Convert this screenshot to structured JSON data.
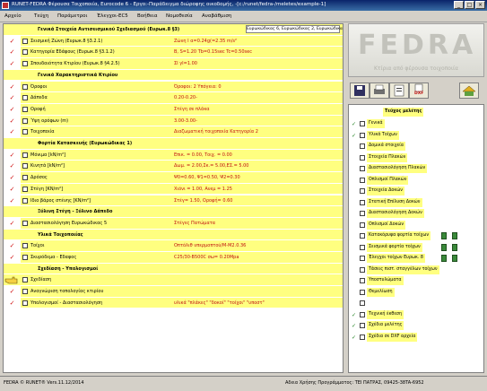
{
  "window": {
    "title": "RUNET-FEDRA Φέρουσα Τοιχοποιία, Eurocode 6 - Εργο:-Παράδειγμα διώροφης οικοδομής, -[c:/runet/fedra-/meletes/example-1]"
  },
  "menu": {
    "items": [
      "Αρχείο",
      "Τεύχη",
      "Παράμετροι",
      "Έλεγχοι-EC5",
      "Βοήθεια",
      "Νομοθεσία",
      "Αναβάθμιση"
    ]
  },
  "grid": {
    "rows": [
      {
        "label": "Γενικά Στοιχεία Αντισεισμικού Σχεδιασμού (Ευρωκ.8 §3)",
        "side": "Ευρωκώδικας 6, Ευρωκώδικας 2, Ευρωκώδικας 8"
      },
      {
        "label": "Σεισμική Ζώνη (Ευρωκ.8 §3.2.1)",
        "value": "Ζώνη   Ι  α=0.24g(=2.35 m/s²"
      },
      {
        "label": "Κατηγορία Εδάφους (Ευρωκ.8 §3.1.2)",
        "value": "B,  S=1.20  Tb=0.15sec  Tc=0.50sec"
      },
      {
        "label": "Σπουδαιότητα Κτιρίου (Ευρωκ.8 §4.2.5)",
        "value": "ΣΙ   γΙ=1.00"
      },
      {
        "label": "Γενικά Χαρακτηριστικά Κτιρίου"
      },
      {
        "label": "Όροφοι",
        "value": "Όροφοι: 2    Υπόγεια: 0"
      },
      {
        "label": "Δάπεδα",
        "value": "0.20-0.20-"
      },
      {
        "label": "Οροφή",
        "value": "Στέγη σε πλάκα"
      },
      {
        "label": "Ύψη ορόφων (m)",
        "value": "3.00-3.00-"
      },
      {
        "label": "Τοιχοποιία",
        "value": "Διαζωματική τοιχοποιία    Κατηγορία 2"
      },
      {
        "label": "Φορτία Κατασκευής (Ευρωκώδικας 1)"
      },
      {
        "label": "Μόνιμα  [kN/m²]",
        "value": "Επικ. = 0.00, Τοιχ. = 0.00"
      },
      {
        "label": "Κινητά  [kN/m²]",
        "value": "Δωμ. = 2.00,Σκ.= 5.00,ΕΣ.= 5.00"
      },
      {
        "label": "Δρόσος",
        "value": "Ψ0=0.60, Ψ1=0.50, Ψ2=0.30"
      },
      {
        "label": "Στέγη [KN/m²]",
        "value": "Χιόνι = 1.00, Ανεμ = 1.25"
      },
      {
        "label": "Ιδιο βάρος στένης [KN/m²]",
        "value": "Στέγ= 1.50, Οροφή= 0.60"
      },
      {
        "label": "Ξύλινη Στέγη - Ξύλινο Δάπεδο"
      },
      {
        "label": "Διαστασιολόγηση Ευρωκώδικας 5",
        "value": "Στέγες          Πατώματα"
      },
      {
        "label": "Υλικά Τοιχοποιίας"
      },
      {
        "label": "Τοίχοι",
        "value": "Οπτόλιθ υπερμοπτού/Μ-Μ2.0.36"
      },
      {
        "label": "Σκυρόδεμα - Εδαφος",
        "value": "C25/30-B500C σω= 0.20Mpa"
      },
      {
        "label": "Σχεδίαση - Υπολογισμοί"
      },
      {
        "label": "Σχεδίαση"
      },
      {
        "label": "Αναγνώριση τοπολογίας κτιρίου"
      },
      {
        "label": "Υπολογισμοί - Διαστασιολόγηση",
        "value": "υλικά \"πλάκες\" \"δοκοί\" \"τοίχοι\" \"υποστ\""
      }
    ]
  },
  "logo": {
    "text": "FEDRA",
    "subtitle": "Κτίρια από φέρουσα τοιχοποιία"
  },
  "toolbar": {
    "dxf_label": "DXF"
  },
  "panel": {
    "header": "Τεύχος μελέτης",
    "items": [
      "Γενικά",
      "Υλικά Τοίχων",
      "Δομικά στοιχεία",
      "Στοιχεία Πλακών",
      "Διαστασιολόγηση Πλακών",
      "Οπλισμοί Πλακών",
      "Στοιχεία Δοκών",
      "Στατική Επίλυση Δοκών",
      "Διαστασιολόγηση Δοκών",
      "Οπλισμοί Δοκών",
      "Κατακόρυφα φορτία τοίχων",
      "Σεισμικά φορτία τοίχων",
      "Έλεγχοι τοίχων Ευρωκ. 8",
      "Τάσεις πιστ. σταγγέλων τοίχων",
      "Υποστυλώματα",
      "Θεμελίωση",
      "",
      "Τεχνική έκθεση",
      "Σχέδια μελέτης",
      "Σχέδια σε DXF αρχεία"
    ]
  },
  "status": {
    "left": "FEDRA © RUNET®  Vers.11.12/2014",
    "right": "Αδεια Χρήσης Προγράμματος: ΤΕΙ ΠΑΤΡΑΣ, 09425-38TA-6952"
  }
}
